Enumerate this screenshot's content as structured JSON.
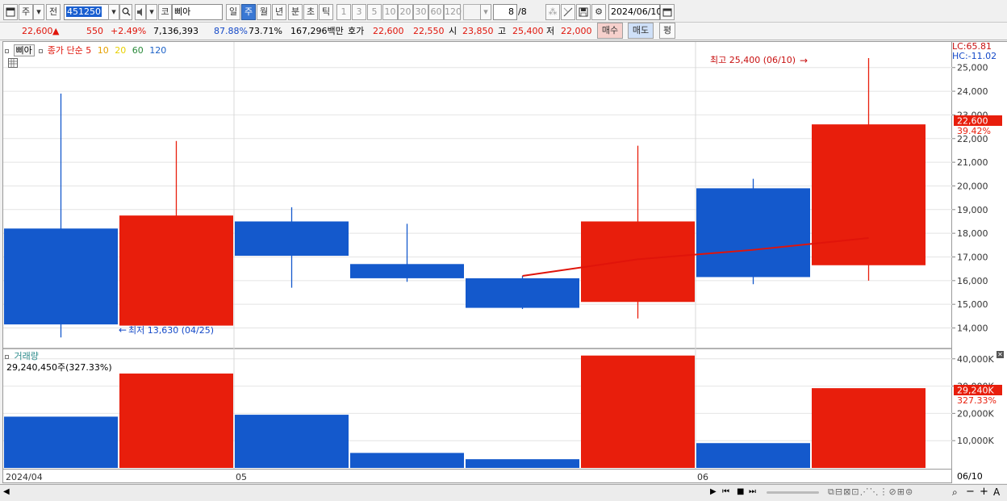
{
  "toolbar": {
    "period_type": "주",
    "prev_label": "전",
    "stock_code": "451250",
    "market_tag": "코",
    "stock_name": "삐아",
    "periods": [
      "일",
      "주",
      "월",
      "년",
      "분",
      "초",
      "틱"
    ],
    "active_period": "주",
    "intervals": [
      "1",
      "3",
      "5",
      "10",
      "20",
      "30",
      "60",
      "120"
    ],
    "page_value": "8",
    "page_total": "/8",
    "date": "2024/06/10"
  },
  "quote": {
    "price": "22,600",
    "change_arrow": "▲",
    "change": "550",
    "change_pct": "+2.49%",
    "volume": "7,136,393",
    "ratio1": "87.88%",
    "ratio2": "73.71%",
    "amount": "167,296백만",
    "bid_label": "호가",
    "bid1": "22,600",
    "bid2": "22,550",
    "open_label": "시",
    "open": "23,850",
    "high_label": "고",
    "high": "25,400",
    "low_label": "저",
    "low": "22,000",
    "buy_label": "매수",
    "sell_label": "매도",
    "eval_label": "평"
  },
  "price_pane": {
    "tab_label": "삐아",
    "ma_label": "종가 단순",
    "ma_periods": [
      "5",
      "10",
      "20",
      "60",
      "120"
    ],
    "ma_colors": [
      "#e0140a",
      "#e6a000",
      "#e8d000",
      "#2a8a3a",
      "#1c62c8"
    ],
    "high_note": "최고 25,400 (06/10)",
    "high_arrow": "→",
    "low_note": "최저 13,630 (04/25)",
    "low_arrow": "←",
    "lc": "LC:65.81",
    "hc": "HC:-11.02",
    "current_price_tag": "22,600",
    "current_pct_tag": "39.42%"
  },
  "volume_pane": {
    "title": "거래량",
    "value_note": "29,240,450주(327.33%)",
    "current_tag": "29,240K",
    "current_pct_tag": "327.33%"
  },
  "x_axis": {
    "labels": [
      "2024/04",
      "05",
      "06"
    ],
    "last_label": "06/10"
  },
  "colors": {
    "up": "#e81e0c",
    "down": "#1459cc",
    "accent": "#3a78d4"
  },
  "chart_data": {
    "type": "candlestick",
    "price_axis": {
      "ticks": [
        "14,000",
        "15,000",
        "16,000",
        "17,000",
        "18,000",
        "19,000",
        "20,000",
        "21,000",
        "22,000",
        "23,000",
        "24,000",
        "25,000"
      ],
      "ylim": [
        13200,
        25400
      ]
    },
    "volume_axis": {
      "ticks": [
        "10,000K",
        "20,000K",
        "30,000K",
        "40,000K"
      ],
      "ylim": [
        0,
        42000
      ]
    },
    "candles": [
      {
        "open": 18200,
        "high": 23900,
        "low": 13600,
        "close": 14150,
        "volume": 18800,
        "up": false
      },
      {
        "open": 14100,
        "high": 21900,
        "low": 14100,
        "close": 18750,
        "volume": 34600,
        "up": true
      },
      {
        "open": 18500,
        "high": 19100,
        "low": 15700,
        "close": 17050,
        "volume": 19500,
        "up": false
      },
      {
        "open": 16700,
        "high": 18400,
        "low": 15950,
        "close": 16100,
        "volume": 5500,
        "up": false
      },
      {
        "open": 16100,
        "high": 16200,
        "low": 14800,
        "close": 14850,
        "volume": 3200,
        "up": false
      },
      {
        "open": 15100,
        "high": 21700,
        "low": 14400,
        "close": 18500,
        "volume": 41200,
        "up": true
      },
      {
        "open": 19900,
        "high": 20300,
        "low": 15850,
        "close": 16150,
        "volume": 9100,
        "up": false
      },
      {
        "open": 16650,
        "high": 25400,
        "low": 16000,
        "close": 22600,
        "volume": 29240,
        "up": true
      }
    ],
    "ma5": {
      "from_index": 4,
      "values": [
        16200,
        16900,
        17300,
        17800
      ]
    }
  }
}
